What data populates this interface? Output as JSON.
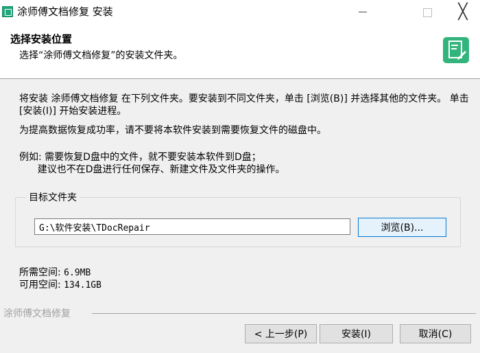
{
  "window": {
    "title": "涂师傅文档修复 安装",
    "minimize": "—",
    "close": "╳"
  },
  "header": {
    "title": "选择安装位置",
    "subtitle": "选择“涂师傅文档修复”的安装文件夹。"
  },
  "content": {
    "instructions": "将安装 涂师傅文档修复 在下列文件夹。要安装到不同文件夹，单击 [浏览(B)] 并选择其他的文件夹。 单击 [安装(I)] 开始安装进程。",
    "tip": "为提高数据恢复成功率，请不要将本软件安装到需要恢复文件的磁盘中。",
    "example": "例如: 需要恢复D盘中的文件，就不要安装本软件到D盘；\n      建议也不在D盘进行任何保存、新建文件及文件夹的操作。",
    "target_folder_label": "目标文件夹",
    "install_path": "G:\\软件安装\\TDocRepair",
    "browse_button": "浏览(B)...",
    "space_required_label": "所需空间:",
    "space_required_value": "6.9MB",
    "space_available_label": "可用空间:",
    "space_available_value": "134.1GB"
  },
  "footer": {
    "brand": "涂师傅文档修复",
    "back_button": "< 上一步(P)",
    "install_button": "安装(I)",
    "cancel_button": "取消(C)"
  },
  "colors": {
    "accent": "#0078d7",
    "icon_green": "#34b47d"
  }
}
